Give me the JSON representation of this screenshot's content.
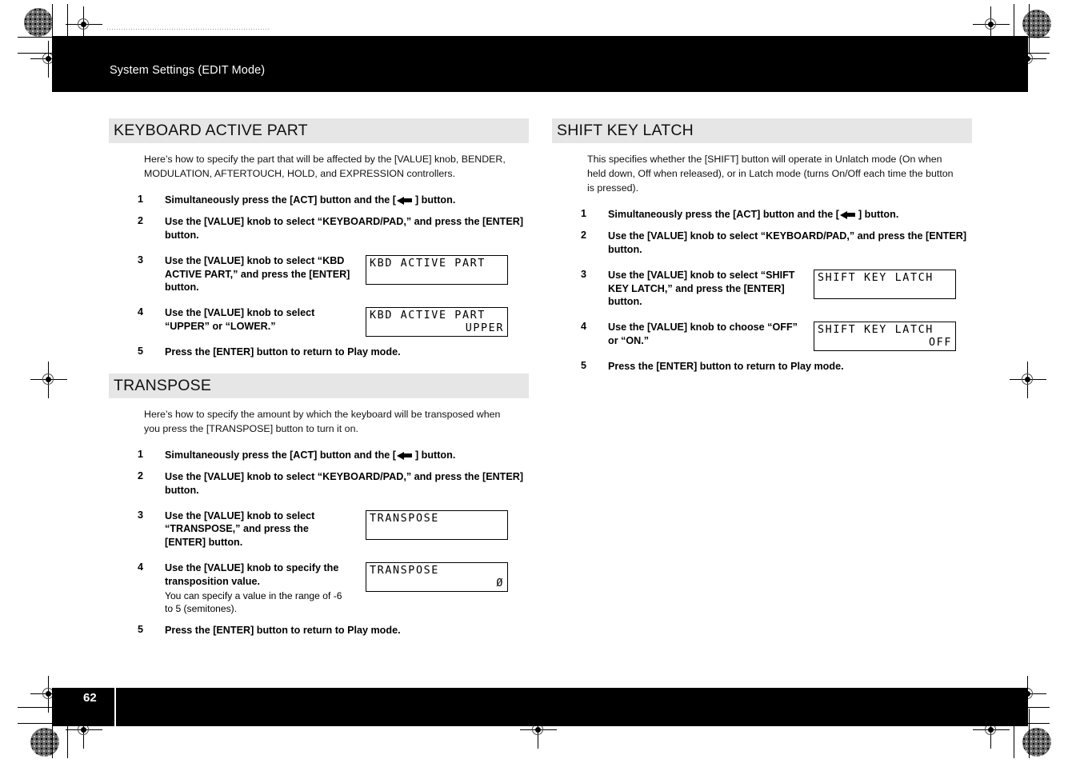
{
  "page": {
    "header_title": "System Settings (EDIT Mode)",
    "top_faint_line": "····································································",
    "page_number": "62"
  },
  "left_column": {
    "sections": [
      {
        "title": "KEYBOARD ACTIVE PART",
        "intro": "Here’s how to specify the part that will be affected by the [VALUE] knob, BENDER, MODULATION, AFTERTOUCH, HOLD, and EXPRESSION controllers.",
        "steps": [
          {
            "num": "1",
            "text_before": "Simultaneously press the [ACT] button and the [",
            "text_after": "] button."
          },
          {
            "num": "2",
            "text": "Use the [VALUE] knob to select “KEYBOARD/PAD,” and press the [ENTER] button."
          },
          {
            "num": "3",
            "text": "Use the [VALUE] knob to select “KBD ACTIVE PART,” and press the [ENTER] button.",
            "lcd": {
              "line1": "KBD ACTIVE PART",
              "line2": ""
            }
          },
          {
            "num": "4",
            "text": "Use the [VALUE] knob to select “UPPER” or “LOWER.”",
            "lcd": {
              "line1": "KBD ACTIVE PART",
              "line2": "UPPER"
            }
          },
          {
            "num": "5",
            "text": "Press the [ENTER] button to return to Play mode."
          }
        ]
      },
      {
        "title": "TRANSPOSE",
        "intro": "Here’s how to specify the amount by which the keyboard will be transposed when you press the [TRANSPOSE] button to turn it on.",
        "steps": [
          {
            "num": "1",
            "text_before": "Simultaneously press the [ACT] button and the [",
            "text_after": "] button."
          },
          {
            "num": "2",
            "text": "Use the [VALUE] knob to select “KEYBOARD/PAD,” and press the [ENTER] button."
          },
          {
            "num": "3",
            "text": "Use the [VALUE] knob to select “TRANSPOSE,” and press the [ENTER] button.",
            "lcd": {
              "line1": "TRANSPOSE",
              "line2": ""
            }
          },
          {
            "num": "4",
            "text": "Use the [VALUE] knob to specify the transposition value.",
            "note": "You can specify a value in the range of -6 to 5 (semitones).",
            "lcd": {
              "line1": "TRANSPOSE",
              "line2": "Ø"
            }
          },
          {
            "num": "5",
            "text": "Press the [ENTER] button to return to Play mode."
          }
        ]
      }
    ]
  },
  "right_column": {
    "sections": [
      {
        "title": "SHIFT KEY LATCH",
        "intro": "This specifies whether the [SHIFT] button will operate in Unlatch mode (On when held down, Off when released), or in Latch mode (turns On/Off each time the button is pressed).",
        "steps": [
          {
            "num": "1",
            "text_before": "Simultaneously press the [ACT] button and the [",
            "text_after": "] button."
          },
          {
            "num": "2",
            "text": "Use the [VALUE] knob to select “KEYBOARD/PAD,” and press the [ENTER] button."
          },
          {
            "num": "3",
            "text": "Use the [VALUE] knob to select “SHIFT KEY LATCH,” and press the [ENTER] button.",
            "lcd": {
              "line1": "SHIFT KEY LATCH",
              "line2": ""
            }
          },
          {
            "num": "4",
            "text": "Use the [VALUE] knob to choose “OFF” or “ON.”",
            "lcd": {
              "line1": "SHIFT KEY LATCH",
              "line2": "OFF"
            }
          },
          {
            "num": "5",
            "text": "Press the [ENTER] button to return to Play mode."
          }
        ]
      }
    ]
  },
  "colors": {
    "section_bar_bg": "#e6e6e6",
    "band_bg": "#000000",
    "text": "#000000",
    "header_text": "#ffffff"
  },
  "icons": {
    "arrow_left_button": "left-arrow-button-glyph",
    "registration": "registration-crosshair-mark",
    "halftone": "halftone-density-circle"
  }
}
